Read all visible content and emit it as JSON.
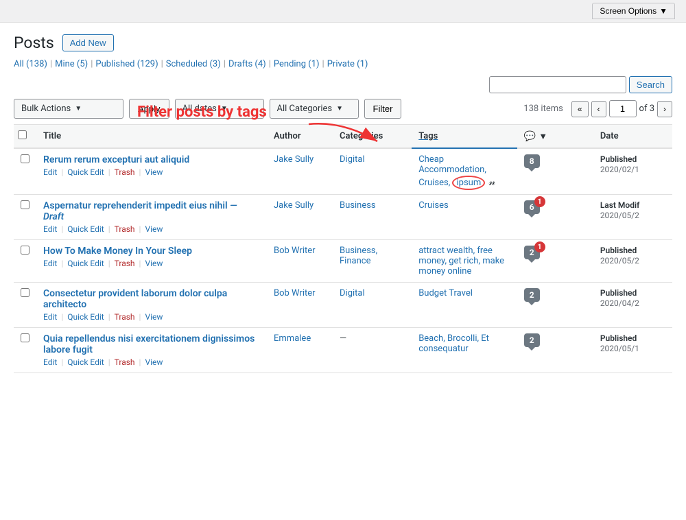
{
  "topbar": {
    "screen_options_label": "Screen Options"
  },
  "header": {
    "title": "Posts",
    "add_new_label": "Add New"
  },
  "filters": {
    "all_label": "All",
    "all_count": "138",
    "mine_label": "Mine",
    "mine_count": "5",
    "published_label": "Published",
    "published_count": "129",
    "scheduled_label": "Scheduled",
    "scheduled_count": "3",
    "drafts_label": "Drafts",
    "drafts_count": "4",
    "pending_label": "Pending",
    "pending_count": "1",
    "private_label": "Private",
    "private_count": "1"
  },
  "search": {
    "placeholder": "",
    "button_label": "Search"
  },
  "tablenav": {
    "bulk_actions_label": "Bulk Actions",
    "apply_label": "Apply",
    "all_dates_label": "All dates",
    "all_categories_label": "All Categories",
    "filter_label": "Filter",
    "items_count": "138 items",
    "of_pages": "of 3",
    "current_page": "1",
    "first_label": "«",
    "prev_label": "‹",
    "next_label": "›"
  },
  "annotation": {
    "text": "Filter posts by tags",
    "arrow": "→"
  },
  "table": {
    "columns": {
      "title": "Title",
      "author": "Author",
      "categories": "Categories",
      "tags": "Tags",
      "date": "Date"
    },
    "rows": [
      {
        "id": 1,
        "title": "Rerum rerum excepturi aut aliquid",
        "author": "Jake Sully",
        "categories": "Digital",
        "tags": "Cheap Accommodation, Cruises, ipsum",
        "tags_parts": [
          "Cheap Accommodation, Cruises, ",
          "ipsum"
        ],
        "comments": "8",
        "comments_badge": "",
        "date_status": "Published",
        "date": "2020/02/1",
        "actions": [
          "Edit",
          "Quick Edit",
          "Trash",
          "View"
        ],
        "is_draft": false
      },
      {
        "id": 2,
        "title": "Aspernatur reprehenderit impedit eius nihil",
        "title_suffix": "— Draft",
        "author": "Jake Sully",
        "categories": "Business",
        "tags": "Cruises",
        "tags_parts": [
          "Cruises"
        ],
        "comments": "6",
        "comments_badge": "1",
        "date_status": "Last Modif",
        "date": "2020/05/2",
        "actions": [
          "Edit",
          "Quick Edit",
          "Trash",
          "View"
        ],
        "is_draft": true
      },
      {
        "id": 3,
        "title": "How To Make Money In Your Sleep",
        "author": "Bob Writer",
        "categories": "Business, Finance",
        "tags": "attract wealth, free money, get rich, make money online",
        "tags_parts": [
          "attract wealth, free money, get rich, make money online"
        ],
        "comments": "2",
        "comments_badge": "1",
        "date_status": "Published",
        "date": "2020/05/2",
        "actions": [
          "Edit",
          "Quick Edit",
          "Trash",
          "View"
        ],
        "is_draft": false
      },
      {
        "id": 4,
        "title": "Consectetur provident laborum dolor culpa architecto",
        "author": "Bob Writer",
        "categories": "Digital",
        "tags": "Budget Travel",
        "tags_parts": [
          "Budget Travel"
        ],
        "comments": "2",
        "comments_badge": "",
        "date_status": "Published",
        "date": "2020/04/2",
        "actions": [
          "Edit",
          "Quick Edit",
          "Trash",
          "View"
        ],
        "is_draft": false
      },
      {
        "id": 5,
        "title": "Quia repellendus nisi exercitationem dignissimos labore fugit",
        "author": "Emmalee",
        "categories": "—",
        "tags": "Beach, Brocolli, Et consequatur",
        "tags_parts": [
          "Beach, Brocolli, Et consequatur"
        ],
        "comments": "2",
        "comments_badge": "",
        "date_status": "Published",
        "date": "2020/05/1",
        "actions": [
          "Edit",
          "Quick Edit",
          "Trash",
          "View"
        ],
        "is_draft": false
      }
    ]
  }
}
